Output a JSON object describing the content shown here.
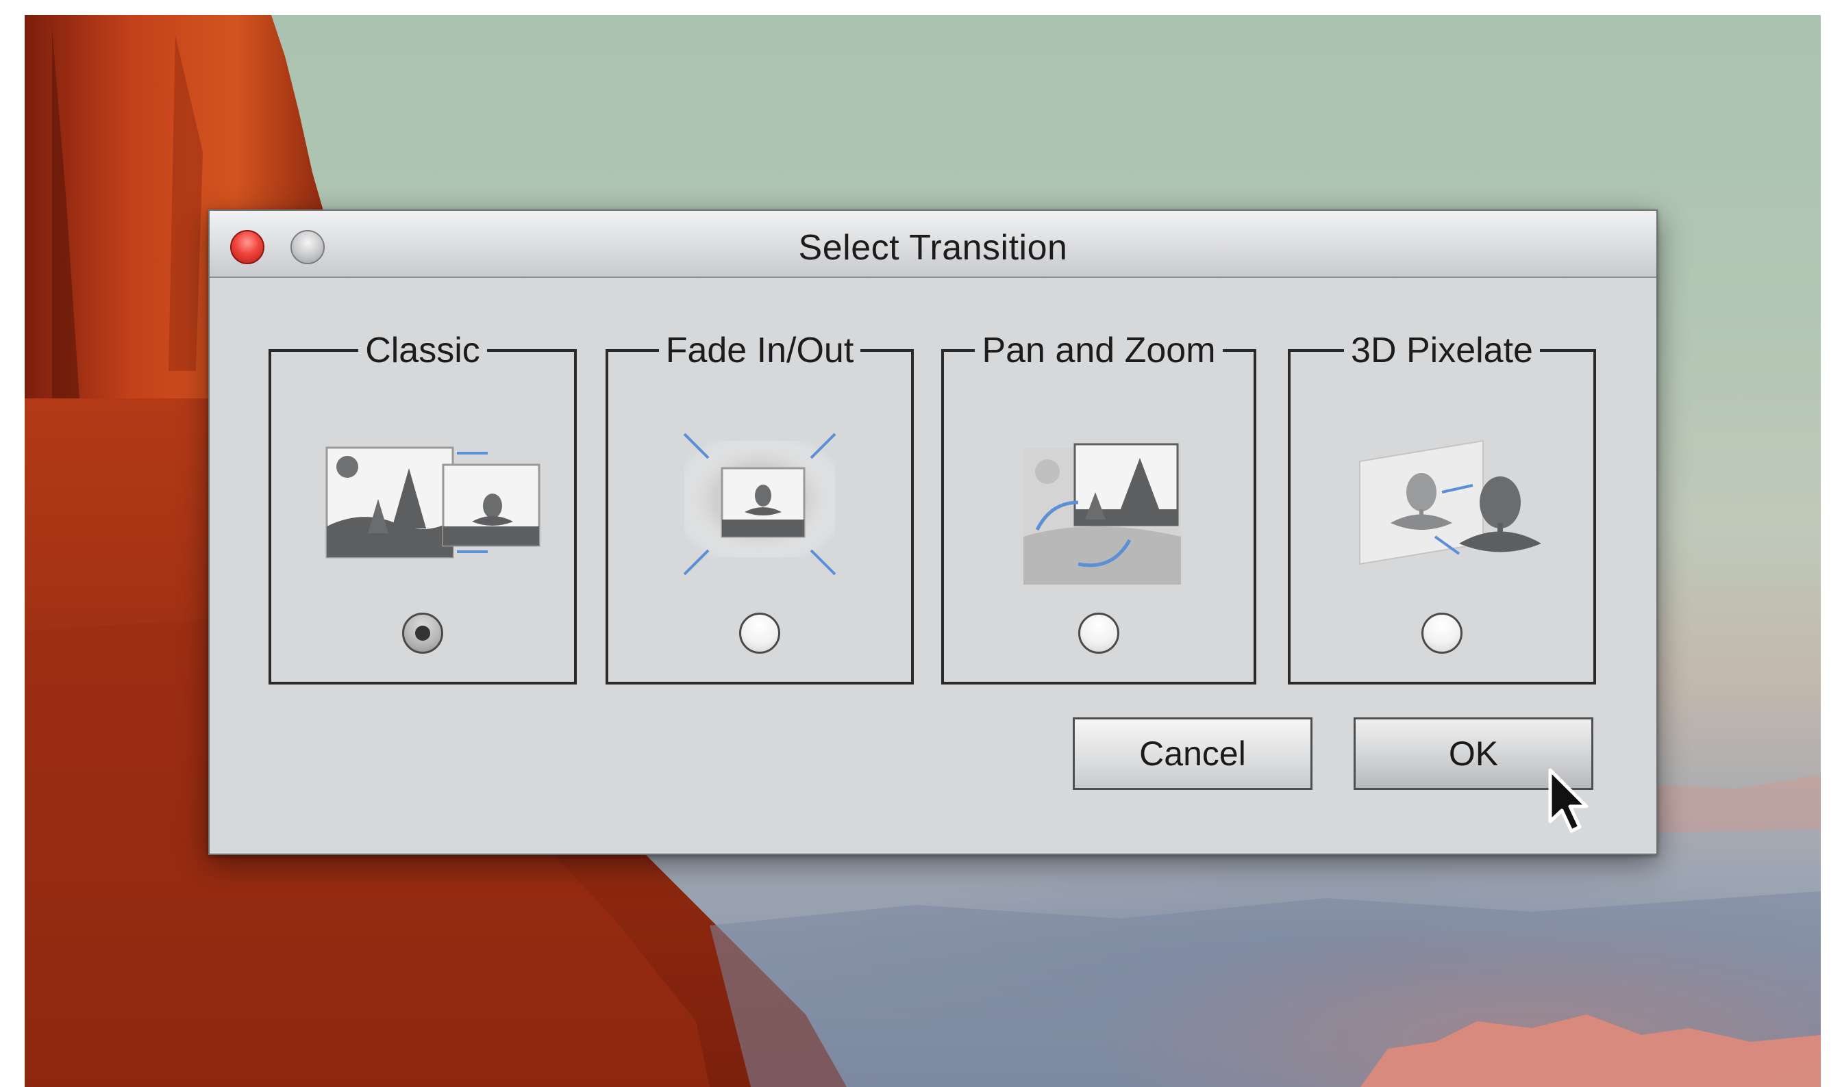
{
  "dialog": {
    "title": "Select Transition",
    "window_controls": [
      {
        "name": "close",
        "icon": "red-circle-close-icon"
      },
      {
        "name": "minimize",
        "icon": "gray-circle-minimize-icon"
      }
    ],
    "options": [
      {
        "label": "Classic",
        "icon": "classic-transition-icon",
        "selected": true
      },
      {
        "label": "Fade In/Out",
        "icon": "fade-transition-icon",
        "selected": false
      },
      {
        "label": "Pan and Zoom",
        "icon": "pan-zoom-transition-icon",
        "selected": false
      },
      {
        "label": "3D Pixelate",
        "icon": "3d-pixelate-transition-icon",
        "selected": false
      }
    ],
    "buttons": {
      "cancel_label": "Cancel",
      "ok_label": "OK"
    }
  },
  "colors": {
    "dialog_bg": "#d6d8da",
    "close_button": "#f0453c",
    "accent_arrows": "#5b8fd6",
    "illustration_gray": "#5d5e60"
  }
}
